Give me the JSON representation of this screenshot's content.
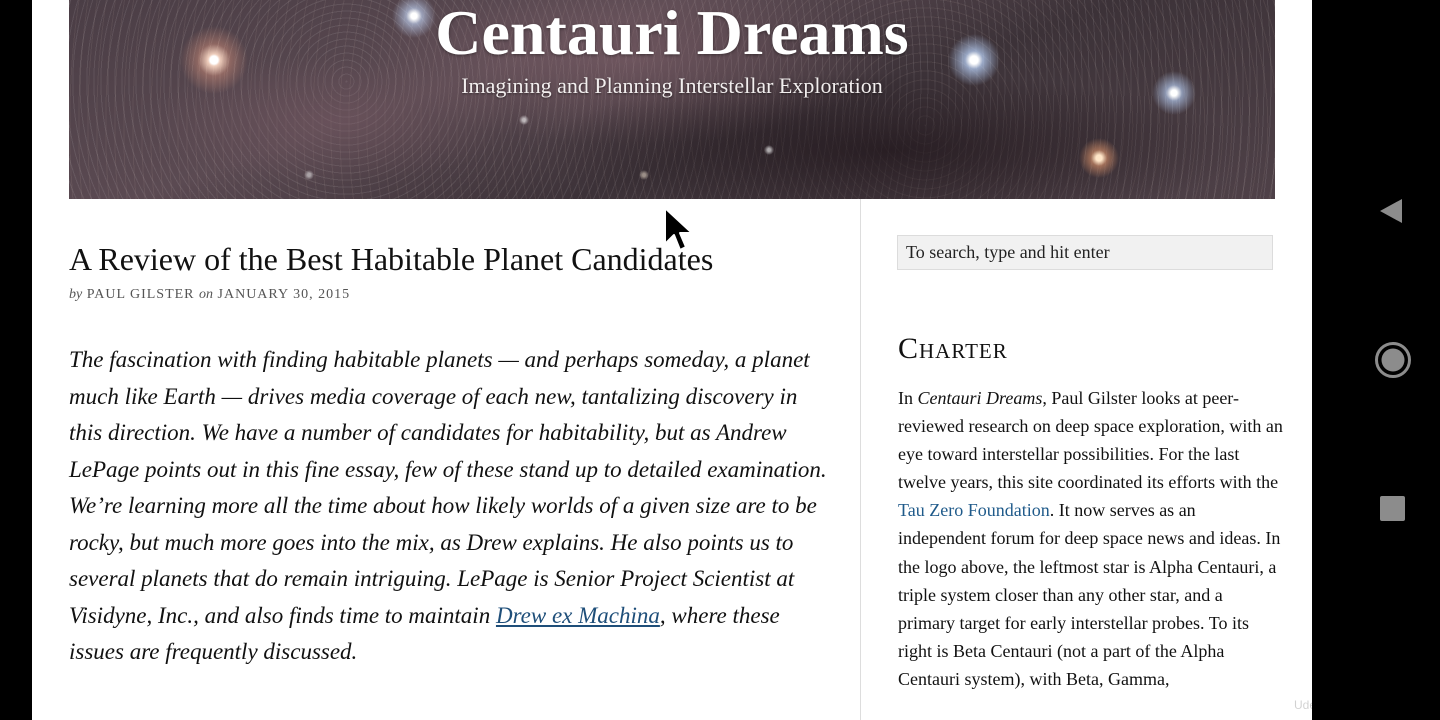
{
  "header": {
    "site_title": "Centauri Dreams",
    "tagline": "Imagining and Planning Interstellar Exploration"
  },
  "post": {
    "title": "A Review of the Best Habitable Planet Candidates",
    "byline_by": "by",
    "author": "Paul Gilster",
    "byline_on": "on",
    "date": "January 30, 2015",
    "lede_before_link": "The fascination with finding habitable planets — and perhaps someday, a planet much like Earth — drives media coverage of each new, tantalizing discovery in this direction. We have a number of candidates for habitability, but as Andrew LePage points out in this fine essay, few of these stand up to detailed examination. We’re learning more all the time about how likely worlds of a given size are to be rocky, but much more goes into the mix, as Drew explains. He also points us to several planets that do remain intriguing. LePage is Senior Project Scientist at Visidyne, Inc., and also finds time to maintain ",
    "lede_link": "Drew ex Machina",
    "lede_after_link": ", where these issues are frequently discussed."
  },
  "sidebar": {
    "search_placeholder": "To search, type and hit enter",
    "charter_title": "Charter",
    "charter_in": "In ",
    "charter_site_name": "Centauri Dreams",
    "charter_text_1": ", Paul Gilster looks at peer-reviewed research on deep space exploration, with an eye toward interstellar possibilities. For the last twelve years, this site coordinated its efforts with the ",
    "charter_link": "Tau Zero Foundation",
    "charter_text_2": ". It now serves as an independent forum for deep space news and ideas. In the logo above, the leftmost star is Alpha Centauri, a triple system closer than any other star, and a primary target for early interstellar probes. To its right is Beta Centauri (not a part of the Alpha Centauri system), with Beta, Gamma,"
  },
  "overlay": {
    "watermark": "Udemy"
  },
  "colors": {
    "link_blue": "#1f5a8a",
    "nav_gray": "#8c8c8c"
  },
  "icons": {
    "nav_back": "triangle-left",
    "nav_home": "circle",
    "nav_recent": "square",
    "cursor": "arrow-pointer"
  }
}
